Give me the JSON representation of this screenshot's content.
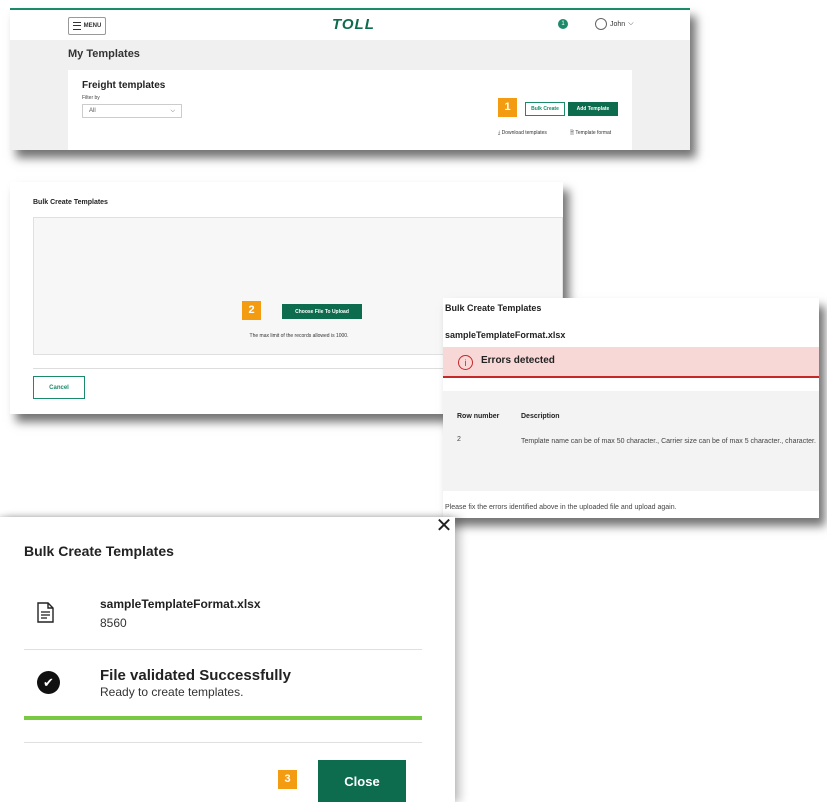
{
  "colors": {
    "accent": "#0d6b4e",
    "step_badge": "#f39c12",
    "error": "#c62828",
    "success_bar": "#7ac943"
  },
  "panel1": {
    "menu_label": "MENU",
    "logo": "TOLL",
    "notification_count": "1",
    "user_name": "John",
    "page_title": "My Templates",
    "section_title": "Freight templates",
    "filter_label": "Filter by",
    "filter_value": "All",
    "step": "1",
    "bulk_create": "Bulk Create",
    "add_template": "Add Template",
    "download_templates": "Download templates",
    "template_format": "Template format"
  },
  "panel2": {
    "title": "Bulk Create Templates",
    "step": "2",
    "choose_file": "Choose File To Upload",
    "limit_note": "The max limit of the records allowed is 1000.",
    "cancel": "Cancel"
  },
  "panel3": {
    "title": "Bulk Create Templates",
    "file_name": "sampleTemplateFormat.xlsx",
    "error_icon_glyph": "i",
    "error_heading": "Errors detected",
    "columns": [
      "Row number",
      "Description"
    ],
    "rows": [
      {
        "row": "2",
        "description": "Template name can be of max 50 character., Carrier size can be of max 5 character., character."
      }
    ],
    "footer_note": "Please fix the errors identified above in the uploaded file and upload again."
  },
  "panel4": {
    "close_glyph": "✕",
    "title": "Bulk Create Templates",
    "file_name": "sampleTemplateFormat.xlsx",
    "file_size": "8560",
    "status_title": "File validated Successfully",
    "status_sub": "Ready to create templates.",
    "step": "3",
    "close_button": "Close"
  }
}
